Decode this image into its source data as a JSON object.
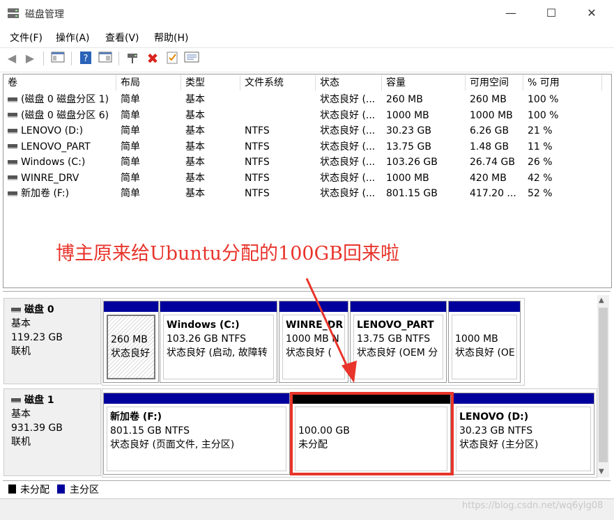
{
  "window": {
    "title": "磁盘管理",
    "controls": {
      "minimize": "—",
      "maximize": "☐",
      "close": "✕"
    }
  },
  "menu": [
    "文件(F)",
    "操作(A)",
    "查看(V)",
    "帮助(H)"
  ],
  "toolbar_icons": [
    "back-icon",
    "forward-icon",
    "show-hide-tree-icon",
    "help-icon",
    "properties-icon",
    "connect-disk-icon",
    "delete-icon",
    "checklist-icon",
    "console-list-icon"
  ],
  "table": {
    "headers": [
      "卷",
      "布局",
      "类型",
      "文件系统",
      "状态",
      "容量",
      "可用空间",
      "% 可用"
    ],
    "rows": [
      [
        "(磁盘 0 磁盘分区 1)",
        "简单",
        "基本",
        "",
        "状态良好 (...",
        "260 MB",
        "260 MB",
        "100 %"
      ],
      [
        "(磁盘 0 磁盘分区 6)",
        "简单",
        "基本",
        "",
        "状态良好 (...",
        "1000 MB",
        "1000 MB",
        "100 %"
      ],
      [
        "LENOVO (D:)",
        "简单",
        "基本",
        "NTFS",
        "状态良好 (...",
        "30.23 GB",
        "6.26 GB",
        "21 %"
      ],
      [
        "LENOVO_PART",
        "简单",
        "基本",
        "NTFS",
        "状态良好 (...",
        "13.75 GB",
        "1.48 GB",
        "11 %"
      ],
      [
        "Windows (C:)",
        "简单",
        "基本",
        "NTFS",
        "状态良好 (...",
        "103.26 GB",
        "26.74 GB",
        "26 %"
      ],
      [
        "WINRE_DRV",
        "简单",
        "基本",
        "NTFS",
        "状态良好 (...",
        "1000 MB",
        "420 MB",
        "42 %"
      ],
      [
        "新加卷 (F:)",
        "简单",
        "基本",
        "NTFS",
        "状态良好 (...",
        "801.15 GB",
        "417.20 ...",
        "52 %"
      ]
    ]
  },
  "annotation": "博主原来给Ubuntu分配的100GB回来啦",
  "disks": [
    {
      "name": "磁盘 0",
      "type": "基本",
      "size": "119.23 GB",
      "status": "联机",
      "partitions": [
        {
          "line1": "",
          "line2": "260 MB",
          "line3": "状态良好"
        },
        {
          "line1": "Windows  (C:)",
          "line2": "103.26 GB NTFS",
          "line3": "状态良好 (启动, 故障转"
        },
        {
          "line1": "WINRE_DR",
          "line2": "1000 MB N",
          "line3": "状态良好 ("
        },
        {
          "line1": "LENOVO_PART",
          "line2": "13.75 GB NTFS",
          "line3": "状态良好 (OEM 分"
        },
        {
          "line1": "",
          "line2": "1000 MB",
          "line3": "状态良好 (OE"
        }
      ]
    },
    {
      "name": "磁盘 1",
      "type": "基本",
      "size": "931.39 GB",
      "status": "联机",
      "partitions": [
        {
          "line1": "新加卷  (F:)",
          "line2": "801.15 GB NTFS",
          "line3": "状态良好 (页面文件, 主分区)"
        },
        {
          "line1": "",
          "line2": "100.00 GB",
          "line3": "未分配"
        },
        {
          "line1": "LENOVO  (D:)",
          "line2": "30.23 GB NTFS",
          "line3": "状态良好 (主分区)"
        }
      ]
    }
  ],
  "legend": {
    "unallocated": "未分配",
    "primary": "主分区"
  },
  "watermark": "https://blog.csdn.net/wq6ylg08",
  "colors": {
    "primary_partition": "#00009c",
    "unallocated": "#000000",
    "annotation": "#e8342b"
  }
}
